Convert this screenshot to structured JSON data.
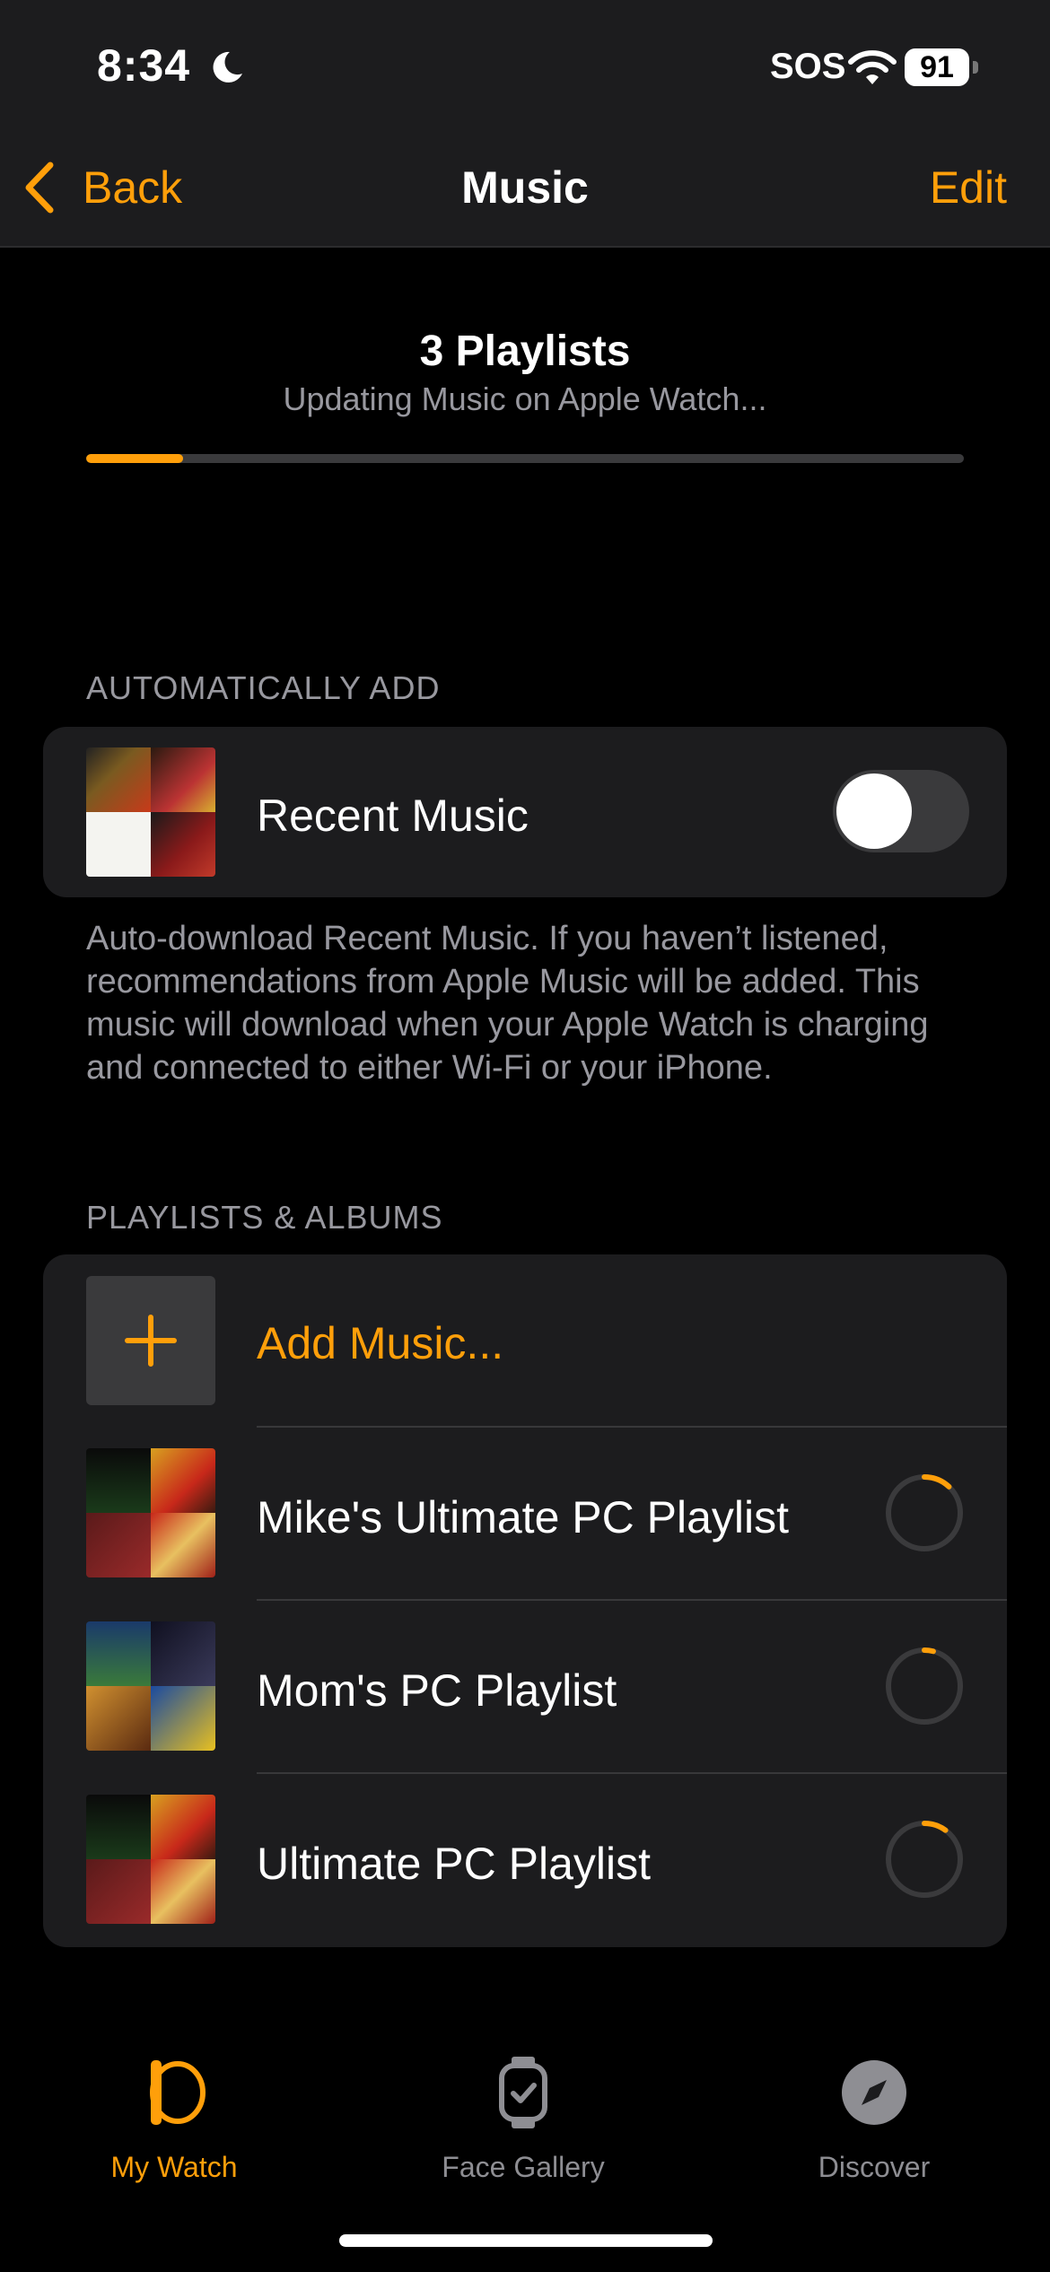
{
  "status_bar": {
    "time": "8:34",
    "sos": "SOS",
    "battery": "91"
  },
  "nav": {
    "back_label": "Back",
    "title": "Music",
    "edit_label": "Edit"
  },
  "sync": {
    "title": "3 Playlists",
    "subtitle": "Updating Music on Apple Watch...",
    "progress": 0.11
  },
  "auto_add": {
    "header": "AUTOMATICALLY ADD",
    "label": "Recent Music",
    "toggle_on": false,
    "footer": "Auto-download Recent Music. If you haven’t listened, recommendations from Apple Music will be added. This music will download when your Apple Watch is charging and connected to either Wi-Fi or your iPhone."
  },
  "playlists": {
    "header": "PLAYLISTS & ALBUMS",
    "add_label": "Add Music...",
    "items": [
      {
        "label": "Mike's Ultimate PC Playlist",
        "progress": 0.12
      },
      {
        "label": "Mom's PC Playlist",
        "progress": 0.04
      },
      {
        "label": "Ultimate PC Playlist",
        "progress": 0.1
      }
    ]
  },
  "tabs": [
    {
      "label": "My Watch",
      "icon": "watch-outline-icon",
      "active": true
    },
    {
      "label": "Face Gallery",
      "icon": "watch-face-gallery-icon",
      "active": false
    },
    {
      "label": "Discover",
      "icon": "compass-icon",
      "active": false
    }
  ],
  "colors": {
    "accent": "#ff9f0a",
    "background": "#000000",
    "card": "#1c1c1e",
    "secondary_text": "#98989f"
  }
}
